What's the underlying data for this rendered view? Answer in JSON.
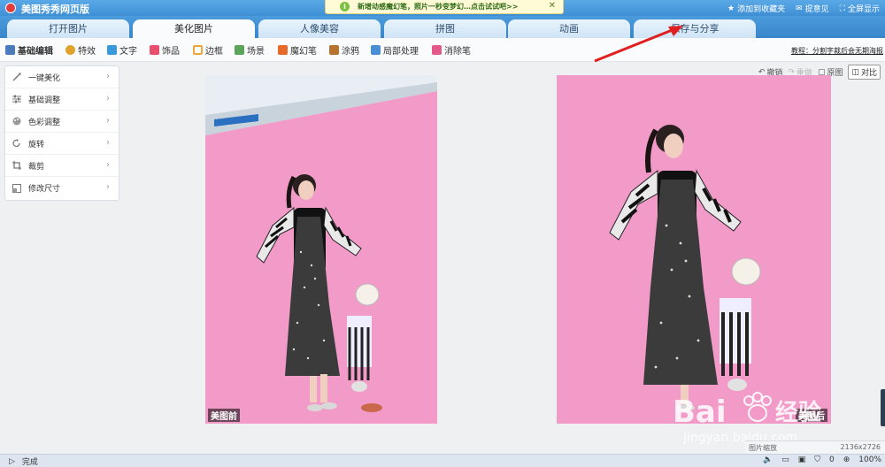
{
  "title_bar": {
    "app_title": "美图秀秀网页版",
    "notice_text": "新增动感魔幻笔，照片一秒变梦幻…点击试试吧>>",
    "links": [
      {
        "label": "添加到收藏夹",
        "icon": "star-icon"
      },
      {
        "label": "提意见",
        "icon": "feedback-icon"
      },
      {
        "label": "全屏显示",
        "icon": "fullscreen-icon"
      }
    ]
  },
  "tabs": [
    {
      "label": "打开图片",
      "active": false
    },
    {
      "label": "美化图片",
      "active": true
    },
    {
      "label": "人像美容",
      "active": false
    },
    {
      "label": "拼图",
      "active": false
    },
    {
      "label": "动画",
      "active": false
    },
    {
      "label": "保存与分享",
      "active": false
    }
  ],
  "toolbar": {
    "items": [
      {
        "label": "基础编辑",
        "icon": "basic-edit-icon",
        "color": "#4a7bbd"
      },
      {
        "label": "特效",
        "icon": "effects-icon",
        "color": "#e0a22a"
      },
      {
        "label": "文字",
        "icon": "text-icon",
        "color": "#3a9ad9"
      },
      {
        "label": "饰品",
        "icon": "accessory-icon",
        "color": "#e8506e"
      },
      {
        "label": "边框",
        "icon": "frame-icon",
        "color": "#e8a83a"
      },
      {
        "label": "场景",
        "icon": "scene-icon",
        "color": "#5aa55a"
      },
      {
        "label": "魔幻笔",
        "icon": "magic-pen-icon",
        "color": "#e86a2a"
      },
      {
        "label": "涂鸦",
        "icon": "doodle-icon",
        "color": "#b5732e"
      },
      {
        "label": "局部处理",
        "icon": "local-process-icon",
        "color": "#4a8fd6"
      },
      {
        "label": "消除笔",
        "icon": "eraser-icon",
        "color": "#e35a8a"
      }
    ],
    "tutorial_link": "教程：分割字裁后会无期海报"
  },
  "left_panel": {
    "items": [
      {
        "label": "一键美化",
        "icon": "magic-wand-icon"
      },
      {
        "label": "基础调整",
        "icon": "sliders-icon"
      },
      {
        "label": "色彩调整",
        "icon": "palette-icon"
      },
      {
        "label": "旋转",
        "icon": "rotate-icon"
      },
      {
        "label": "裁剪",
        "icon": "crop-icon"
      },
      {
        "label": "修改尺寸",
        "icon": "resize-icon"
      }
    ]
  },
  "actions": {
    "undo": "撤销",
    "redo": "重做",
    "original": "原图",
    "compare": "对比"
  },
  "photos": {
    "before_label": "美图前",
    "after_label": "美图后"
  },
  "status_bar": {
    "status": "完成",
    "zoom_label": "图片缩放",
    "image_size": "2136x2726",
    "counter": "0",
    "zoom_percent": "100%"
  },
  "watermark": {
    "brand": "Bai",
    "brand_cn": "经验",
    "url": "jingyan.baidu.com"
  },
  "colors": {
    "title_bar": "#4a9de0",
    "accent_red": "#e02020",
    "photo_bg": "#f29ac8"
  }
}
